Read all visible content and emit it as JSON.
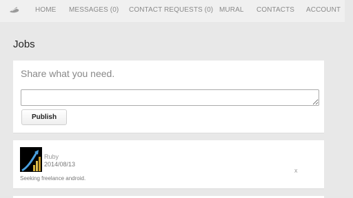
{
  "nav": {
    "logo_icon": "hand-logo-icon",
    "items": [
      {
        "label": "HOME"
      },
      {
        "label": "MESSAGES (0)"
      },
      {
        "label": "CONTACT REQUESTS (0)"
      },
      {
        "label": "MURAL"
      },
      {
        "label": "CONTACTS"
      },
      {
        "label": "ACCOUNT"
      }
    ]
  },
  "page": {
    "title": "Jobs"
  },
  "share": {
    "prompt": "Share what you need.",
    "textarea_value": "",
    "publish_label": "Publish"
  },
  "posts": [
    {
      "author": "Ruby",
      "date": "2014/08/13",
      "text": "Seeking freelance android.",
      "delete_label": "x",
      "avatar_icon": "bar-chart-arrow-avatar"
    }
  ],
  "colors": {
    "background": "#e8e8e8",
    "nav_background": "#f0f0f0",
    "card_background": "#ffffff",
    "nav_text": "#8a8a8a"
  }
}
